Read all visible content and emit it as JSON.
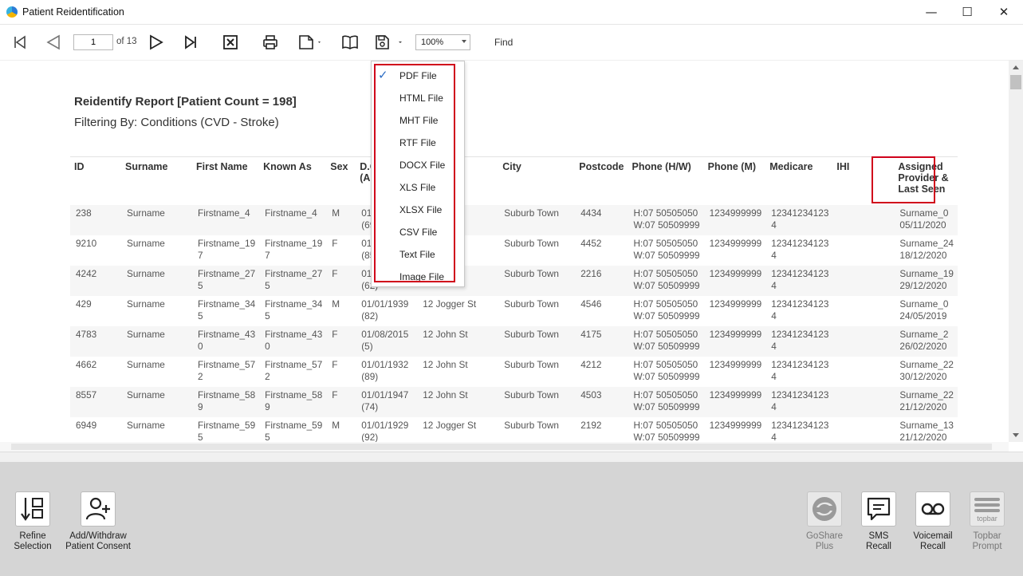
{
  "window": {
    "title": "Patient Reidentification",
    "minimize": "—",
    "maximize": "☐",
    "close": "✕"
  },
  "toolbar": {
    "page_current": "1",
    "page_of": "of 13",
    "zoom": "100%",
    "find": "Find"
  },
  "report": {
    "title": "Reidentify Report  [Patient Count = 198]",
    "filter": "Filtering By: Conditions (CVD - Stroke)",
    "columns": [
      "ID",
      "Surname",
      "First Name",
      "Known As",
      "Sex",
      "D.O.B",
      "",
      "City",
      "Postcode",
      "Phone (H/W)",
      "Phone (M)",
      "Medicare",
      "IHI",
      "Assigned\nProvider &\nLast Seen"
    ],
    "col_dob": "D.O.",
    "col_dob2": "(Age",
    "col_prov1": "Assigned",
    "col_prov2": "Provider &",
    "col_prov3": "Last Seen",
    "rows": [
      {
        "id": "238",
        "surname": "Surname",
        "first1": "Firstname_4",
        "first2": "",
        "known1": "Firstname_4",
        "known2": "",
        "sex": "M",
        "dob1": "01/0",
        "dob2": "(69)",
        "addr": "",
        "city": "Suburb Town",
        "postcode": "4434",
        "phone_h": "H:07 50505050",
        "phone_w": "W:07 50509999",
        "mobile": "1234999999",
        "medicare1": "12341234123",
        "medicare2": "4",
        "ihi": "",
        "prov1": "Surname_0",
        "prov2": "05/11/2020"
      },
      {
        "id": "9210",
        "surname": "Surname",
        "first1": "Firstname_19",
        "first2": "7",
        "known1": "Firstname_19",
        "known2": "7",
        "sex": "F",
        "dob1": "01/0",
        "dob2": "(85)",
        "addr": "",
        "city": "Suburb Town",
        "postcode": "4452",
        "phone_h": "H:07 50505050",
        "phone_w": "W:07 50509999",
        "mobile": "1234999999",
        "medicare1": "12341234123",
        "medicare2": "4",
        "ihi": "",
        "prov1": "Surname_24",
        "prov2": "18/12/2020"
      },
      {
        "id": "4242",
        "surname": "Surname",
        "first1": "Firstname_27",
        "first2": "5",
        "known1": "Firstname_27",
        "known2": "5",
        "sex": "F",
        "dob1": "01/0",
        "dob2": "(62)",
        "addr": "",
        "city": "Suburb Town",
        "postcode": "2216",
        "phone_h": "H:07 50505050",
        "phone_w": "W:07 50509999",
        "mobile": "1234999999",
        "medicare1": "12341234123",
        "medicare2": "4",
        "ihi": "",
        "prov1": "Surname_19",
        "prov2": "29/12/2020"
      },
      {
        "id": "429",
        "surname": "Surname",
        "first1": "Firstname_34",
        "first2": "5",
        "known1": "Firstname_34",
        "known2": "5",
        "sex": "M",
        "dob1": "01/01/1939",
        "dob2": "(82)",
        "addr": "12 Jogger St",
        "city": "Suburb Town",
        "postcode": "4546",
        "phone_h": "H:07 50505050",
        "phone_w": "W:07 50509999",
        "mobile": "1234999999",
        "medicare1": "12341234123",
        "medicare2": "4",
        "ihi": "",
        "prov1": "Surname_0",
        "prov2": "24/05/2019"
      },
      {
        "id": "4783",
        "surname": "Surname",
        "first1": "Firstname_43",
        "first2": "0",
        "known1": "Firstname_43",
        "known2": "0",
        "sex": "F",
        "dob1": "01/08/2015",
        "dob2": "(5)",
        "addr": "12 John St",
        "city": "Suburb Town",
        "postcode": "4175",
        "phone_h": "H:07 50505050",
        "phone_w": "W:07 50509999",
        "mobile": "1234999999",
        "medicare1": "12341234123",
        "medicare2": "4",
        "ihi": "",
        "prov1": "Surname_2",
        "prov2": "26/02/2020"
      },
      {
        "id": "4662",
        "surname": "Surname",
        "first1": "Firstname_57",
        "first2": "2",
        "known1": "Firstname_57",
        "known2": "2",
        "sex": "F",
        "dob1": "01/01/1932",
        "dob2": "(89)",
        "addr": "12 John St",
        "city": "Suburb Town",
        "postcode": "4212",
        "phone_h": "H:07 50505050",
        "phone_w": "W:07 50509999",
        "mobile": "1234999999",
        "medicare1": "12341234123",
        "medicare2": "4",
        "ihi": "",
        "prov1": "Surname_22",
        "prov2": "30/12/2020"
      },
      {
        "id": "8557",
        "surname": "Surname",
        "first1": "Firstname_58",
        "first2": "9",
        "known1": "Firstname_58",
        "known2": "9",
        "sex": "F",
        "dob1": "01/01/1947",
        "dob2": "(74)",
        "addr": "12 John St",
        "city": "Suburb Town",
        "postcode": "4503",
        "phone_h": "H:07 50505050",
        "phone_w": "W:07 50509999",
        "mobile": "1234999999",
        "medicare1": "12341234123",
        "medicare2": "4",
        "ihi": "",
        "prov1": "Surname_22",
        "prov2": "21/12/2020"
      },
      {
        "id": "6949",
        "surname": "Surname",
        "first1": "Firstname_59",
        "first2": "5",
        "known1": "Firstname_59",
        "known2": "5",
        "sex": "M",
        "dob1": "01/01/1929",
        "dob2": "(92)",
        "addr": "12 Jogger St",
        "city": "Suburb Town",
        "postcode": "2192",
        "phone_h": "H:07 50505050",
        "phone_w": "W:07 50509999",
        "mobile": "1234999999",
        "medicare1": "12341234123",
        "medicare2": "4",
        "ihi": "",
        "prov1": "Surname_13",
        "prov2": "21/12/2020"
      }
    ]
  },
  "save_menu": {
    "items": [
      "PDF File",
      "HTML File",
      "MHT File",
      "RTF File",
      "DOCX File",
      "XLS File",
      "XLSX File",
      "CSV File",
      "Text File",
      "Image File"
    ],
    "checked": "✓",
    "highlight_color": "#d0021b"
  },
  "bottom": {
    "refine_1": "Refine",
    "refine_2": "Selection",
    "consent_1": "Add/Withdraw",
    "consent_2": "Patient Consent",
    "goshare_1": "GoShare",
    "goshare_2": "Plus",
    "sms_1": "SMS",
    "sms_2": "Recall",
    "voicemail_1": "Voicemail",
    "voicemail_2": "Recall",
    "topbar_1": "Topbar",
    "topbar_2": "Prompt",
    "topbar_logo": "topbar"
  }
}
